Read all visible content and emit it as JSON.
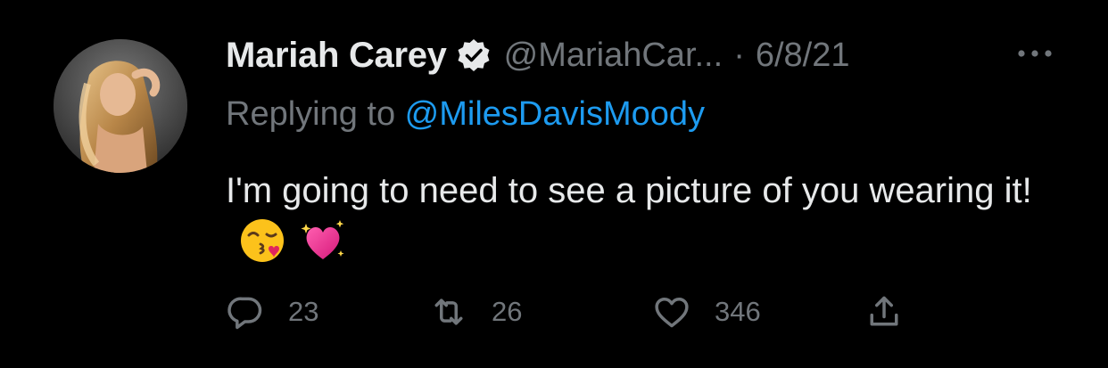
{
  "tweet": {
    "author": {
      "name": "Mariah Carey",
      "handle": "@MariahCar...",
      "verified": true
    },
    "separator": "·",
    "date": "6/8/21",
    "reply": {
      "prefix": "Replying to ",
      "mention": "@MilesDavisMoody"
    },
    "text": "I'm going to need to see a picture of you wearing it!",
    "emojis": [
      "face-blowing-kiss-emoji",
      "sparkling-heart-emoji"
    ],
    "actions": {
      "replies": "23",
      "retweets": "26",
      "likes": "346"
    }
  },
  "colors": {
    "background": "#000000",
    "primary_text": "#e7e9ea",
    "secondary_text": "#71767b",
    "link": "#1d9bf0"
  }
}
